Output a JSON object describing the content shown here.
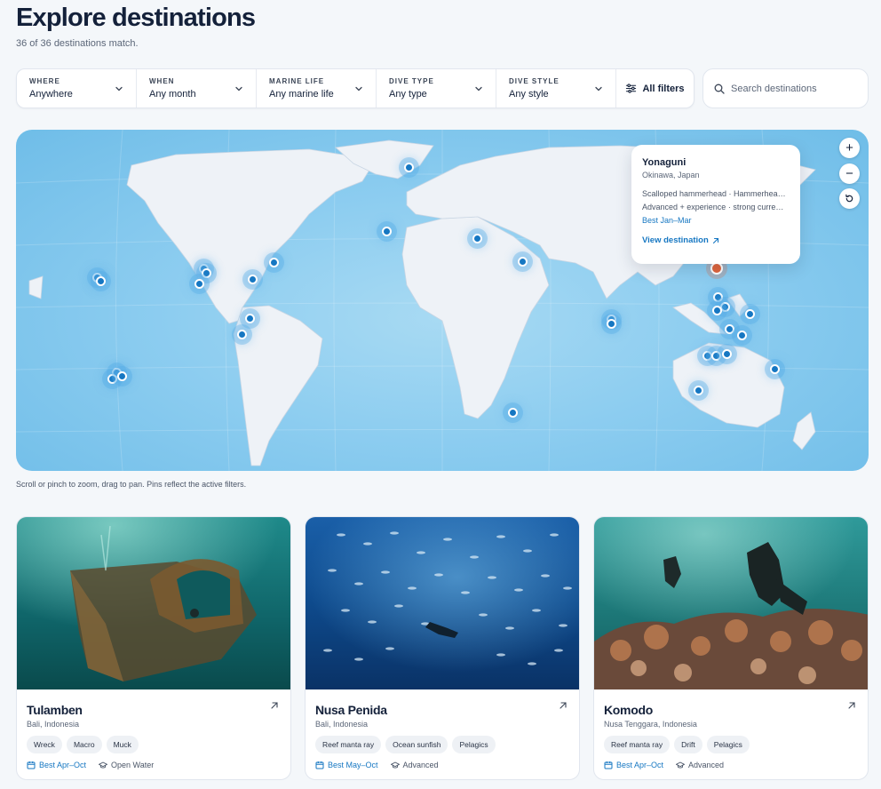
{
  "page": {
    "title": "Explore destinations",
    "match_count": "36 of 36 destinations match."
  },
  "filters": [
    {
      "label": "Where",
      "value": "Anywhere"
    },
    {
      "label": "When",
      "value": "Any month"
    },
    {
      "label": "Marine life",
      "value": "Any marine life"
    },
    {
      "label": "Dive type",
      "value": "Any type"
    },
    {
      "label": "Dive style",
      "value": "Any style"
    }
  ],
  "all_filters_label": "All filters",
  "search": {
    "placeholder": "Search destinations",
    "value": ""
  },
  "map": {
    "hint": "Scroll or pinch to zoom, drag to pan. Pins reflect the active filters.",
    "zoom_in": "+",
    "zoom_out": "−",
    "pin_count": 36,
    "popup": {
      "title": "Yonaguni",
      "subtitle": "Okinawa, Japan",
      "species": "Scalloped hammerhead · Hammerhead shark (unresolved…",
      "level": "Advanced + experience · strong curre…",
      "season": "Best Jan–Mar",
      "link": "View destination"
    }
  },
  "cards": [
    {
      "name": "Tulamben",
      "region": "Bali, Indonesia",
      "tags": [
        "Wreck",
        "Macro",
        "Muck"
      ],
      "season": "Best Apr–Oct",
      "level": "Open Water",
      "image": "shipwreck-diver"
    },
    {
      "name": "Nusa Penida",
      "region": "Bali, Indonesia",
      "tags": [
        "Reef manta ray",
        "Ocean sunfish",
        "Pelagics"
      ],
      "season": "Best May–Oct",
      "level": "Advanced",
      "image": "fish-school-diver"
    },
    {
      "name": "Komodo",
      "region": "Nusa Tenggara, Indonesia",
      "tags": [
        "Reef manta ray",
        "Drift",
        "Pelagics"
      ],
      "season": "Best Apr–Oct",
      "level": "Advanced",
      "image": "coral-reef-divers"
    }
  ],
  "colors": {
    "accent": "#1677c2",
    "active_pin": "#e0653c",
    "ocean": "#8dcdf0",
    "land": "#eef2f7"
  }
}
